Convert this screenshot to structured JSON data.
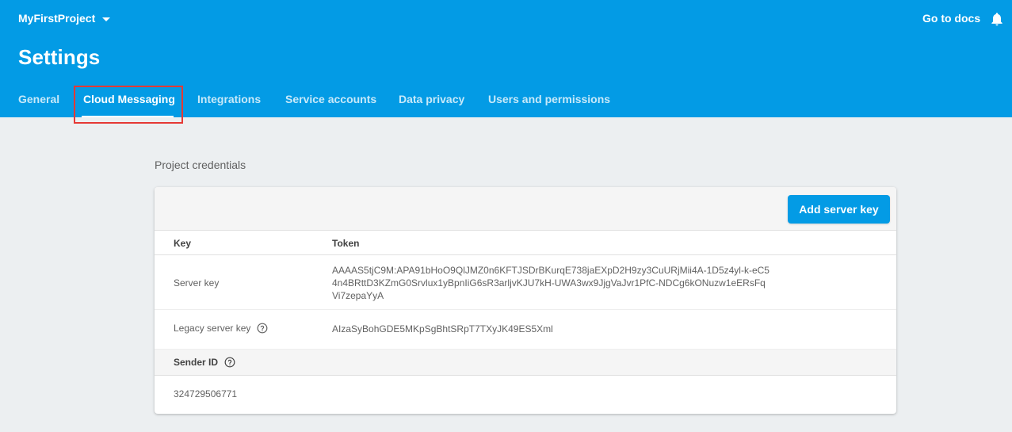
{
  "header": {
    "project_name": "MyFirstProject",
    "docs_link": "Go to docs",
    "page_title": "Settings"
  },
  "tabs": [
    {
      "label": "General",
      "active": false
    },
    {
      "label": "Cloud Messaging",
      "active": true
    },
    {
      "label": "Integrations",
      "active": false
    },
    {
      "label": "Service accounts",
      "active": false
    },
    {
      "label": "Data privacy",
      "active": false
    },
    {
      "label": "Users and permissions",
      "active": false
    }
  ],
  "credentials": {
    "section_label": "Project credentials",
    "add_button": "Add server key",
    "columns": {
      "key": "Key",
      "token": "Token"
    },
    "rows": [
      {
        "key": "Server key",
        "token_lines": [
          "AAAAS5tjC9M:APA91bHoO9QlJMZ0n6KFTJSDrBKurqE738jaEXpD2H9zy3CuURjMii4A-1D5z4yl-k-eC5",
          "4n4BRttD3KZmG0Srvlux1yBpnIiG6sR3arljvKJU7kH-UWA3wx9JjgVaJvr1PfC-NDCg6kONuzw1eERsFq",
          "Vi7zepaYyA"
        ]
      },
      {
        "key": "Legacy server key",
        "token": "AIzaSyBohGDE5MKpSgBhtSRpT7TXyJK49ES5Xml"
      }
    ],
    "sender_label": "Sender ID",
    "sender_value": "324729506771"
  },
  "colors": {
    "brand": "#039be5",
    "highlight": "#e53935"
  },
  "icons": {
    "caret": "chevron-down-icon",
    "bell": "bell-icon",
    "help": "help-circle-icon"
  }
}
